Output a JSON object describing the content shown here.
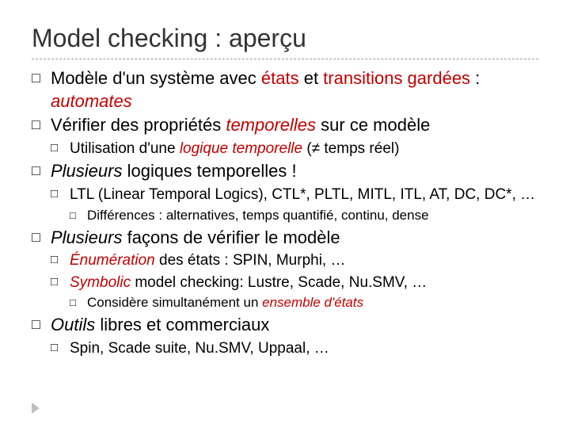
{
  "title": "Model checking : aperçu",
  "b1": {
    "pre": "Modèle d'un système avec ",
    "etats": "états",
    "mid1": " et ",
    "trans": "transitions gardées",
    "mid2": " : ",
    "auto": "automates"
  },
  "b2": {
    "pre": "Vérifier des propriétés ",
    "temp": "temporelles",
    "post": " sur ce modèle",
    "sub": {
      "pre": "Utilisation d'une ",
      "lt": "logique temporelle",
      "post": " (≠ temps réel)"
    }
  },
  "b3": {
    "pre": "Plusieurs",
    "post": " logiques temporelles !",
    "sub1": "LTL (Linear Temporal Logics), CTL*, PLTL, MITL, ITL, AT, DC, DC*, …",
    "subsub": "Différences : alternatives, temps quantifié, continu, dense"
  },
  "b4": {
    "pre": "Plusieurs",
    "post": " façons de vérifier le modèle",
    "sub1": {
      "enum": "Énumération",
      "rest": " des états : SPIN, Murphi, …"
    },
    "sub2": {
      "sym": "Symbolic",
      "rest": " model checking: Lustre, Scade, Nu.SMV, …"
    },
    "subsub": {
      "pre": "Considère simultanément un ",
      "ens": "ensemble d'états"
    }
  },
  "b5": {
    "pre": "Outils",
    "post": " libres et commerciaux",
    "sub": "Spin, Scade suite, Nu.SMV, Uppaal, …"
  }
}
